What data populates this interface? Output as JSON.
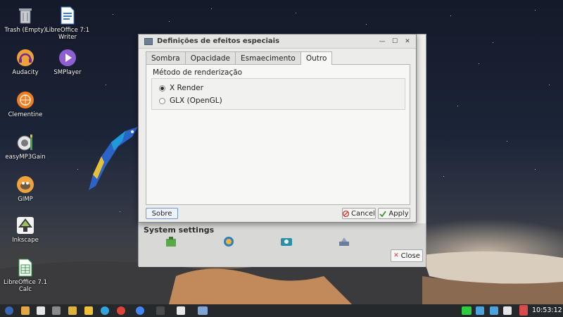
{
  "desktop": {
    "icons": [
      {
        "name": "trash",
        "label": "Trash (Empty)"
      },
      {
        "name": "libreoffice-writer",
        "label": "LibreOffice 7.1 Writer"
      },
      {
        "name": "audacity",
        "label": "Audacity"
      },
      {
        "name": "smplayer",
        "label": "SMPlayer"
      },
      {
        "name": "clementine",
        "label": "Clementine"
      },
      {
        "name": "easymp3gain",
        "label": "easyMP3Gain"
      },
      {
        "name": "gimp",
        "label": "GIMP"
      },
      {
        "name": "inkscape",
        "label": "Inkscape"
      },
      {
        "name": "libreoffice-calc",
        "label": "LibreOffice 7.1 Calc"
      }
    ]
  },
  "background_window": {
    "section_label": "System settings",
    "close_label": "Close",
    "close_icon": "close-icon"
  },
  "dialog": {
    "title": "Definições de efeitos especiais",
    "tabs": [
      {
        "label": "Sombra",
        "active": false
      },
      {
        "label": "Opacidade",
        "active": false
      },
      {
        "label": "Esmaecimento",
        "active": false
      },
      {
        "label": "Outro",
        "active": true
      }
    ],
    "group_title": "Método de renderização",
    "options": [
      {
        "label": "X Render",
        "selected": true
      },
      {
        "label": "GLX (OpenGL)",
        "selected": false
      }
    ],
    "about_label": "Sobre",
    "cancel_label": "Cancel",
    "apply_label": "Apply"
  },
  "taskbar": {
    "clock": "10:53:12",
    "icons": [
      "start-menu-icon",
      "file-manager-icon",
      "control-center-icon",
      "toggle-icon",
      "folder-icon",
      "telegram-icon",
      "chrome-icon",
      "chromium-icon",
      "terminal-icon",
      "settings-icon",
      "window-icon"
    ],
    "tray": [
      "wifi-icon",
      "chat-icon",
      "notification-icon",
      "volume-icon",
      "user-icon"
    ]
  },
  "colors": {
    "accent": "#4a90d9",
    "cancel_red": "#d9302c",
    "apply_green": "#3c9a2e"
  }
}
